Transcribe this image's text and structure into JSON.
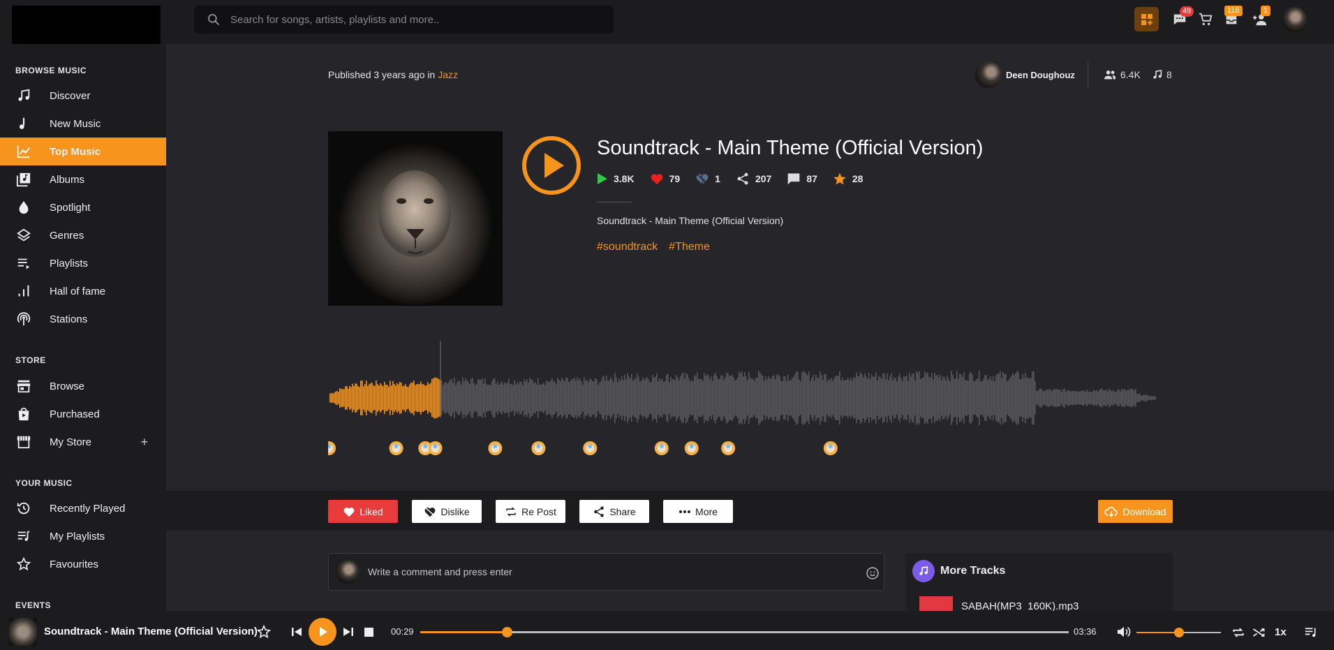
{
  "search": {
    "placeholder": "Search for songs, artists, playlists and more.."
  },
  "header": {
    "messages_badge": "49",
    "notifications_badge": "116",
    "friend_requests_badge": "1"
  },
  "sidebar": {
    "browse_title": "BROWSE MUSIC",
    "browse_items": [
      {
        "label": "Discover",
        "icon": "music-note-icon"
      },
      {
        "label": "New Music",
        "icon": "single-note-icon"
      },
      {
        "label": "Top Music",
        "icon": "trending-icon",
        "active": true
      },
      {
        "label": "Albums",
        "icon": "album-icon"
      },
      {
        "label": "Spotlight",
        "icon": "drop-icon"
      },
      {
        "label": "Genres",
        "icon": "layers-icon"
      },
      {
        "label": "Playlists",
        "icon": "playlist-icon"
      },
      {
        "label": "Hall of fame",
        "icon": "bar-chart-icon"
      },
      {
        "label": "Stations",
        "icon": "radio-icon"
      }
    ],
    "store_title": "STORE",
    "store_items": [
      {
        "label": "Browse",
        "icon": "storefront-icon"
      },
      {
        "label": "Purchased",
        "icon": "shopping-bag-icon"
      },
      {
        "label": "My Store",
        "icon": "store-icon"
      }
    ],
    "your_music_title": "YOUR MUSIC",
    "your_music_items": [
      {
        "label": "Recently Played",
        "icon": "history-icon"
      },
      {
        "label": "My Playlists",
        "icon": "queue-music-icon"
      },
      {
        "label": "Favourites",
        "icon": "star-outline-icon"
      }
    ],
    "events_title": "EVENTS"
  },
  "track": {
    "published_prefix": "Published 3 years ago in",
    "genre": "Jazz",
    "artist": "Deen Doughouz",
    "followers": "6.4K",
    "track_count": "8",
    "title": "Soundtrack - Main Theme (Official Version)",
    "plays": "3.8K",
    "likes": "79",
    "dislikes": "1",
    "shares": "207",
    "comments": "87",
    "rating": "28",
    "description": "Soundtrack - Main Theme (Official Version)",
    "tags": [
      "#soundtrack",
      "#Theme"
    ],
    "progress": 0.133
  },
  "actions": {
    "liked": "Liked",
    "dislike": "Dislike",
    "repost": "Re Post",
    "share": "Share",
    "more": "More",
    "download": "Download"
  },
  "comment": {
    "placeholder": "Write a comment and press enter"
  },
  "more_tracks": {
    "title": "More Tracks",
    "items": [
      "SABAH(MP3_160K).mp3"
    ]
  },
  "player": {
    "title": "Soundtrack - Main Theme (Official Version)",
    "current_time": "00:29",
    "duration": "03:36",
    "progress": 0.134,
    "volume": 0.5,
    "speed": "1x"
  },
  "colors": {
    "accent": "#f7941d",
    "liked": "#e83b3b",
    "play_green": "#2ecc40",
    "background": "#26262a",
    "panel": "#1c1c1f"
  }
}
